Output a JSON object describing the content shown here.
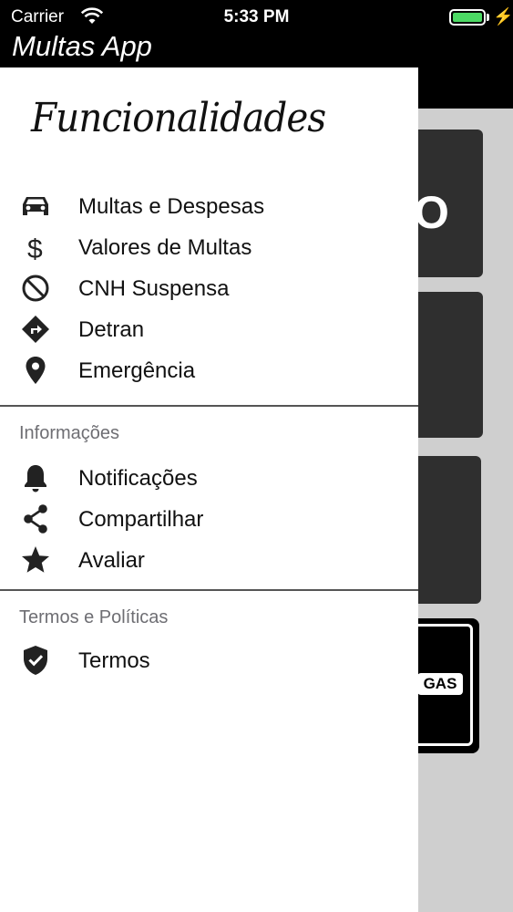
{
  "status_bar": {
    "carrier": "Carrier",
    "time": "5:33 PM",
    "battery_level": 1.0
  },
  "nav": {
    "title": "Multas App"
  },
  "background": {
    "card1_text": "O",
    "sign_label": "GAS"
  },
  "drawer": {
    "title": "Funcionalidades",
    "main_items": [
      {
        "label": "Multas e Despesas",
        "icon": "car-icon"
      },
      {
        "label": "Valores de Multas",
        "icon": "dollar-icon"
      },
      {
        "label": "CNH Suspensa",
        "icon": "block-icon"
      },
      {
        "label": "Detran",
        "icon": "directions-icon"
      },
      {
        "label": "Emergência",
        "icon": "location-pin-icon"
      }
    ],
    "info_section": {
      "title": "Informações",
      "items": [
        {
          "label": "Notificações",
          "icon": "bell-icon"
        },
        {
          "label": "Compartilhar",
          "icon": "share-icon"
        },
        {
          "label": "Avaliar",
          "icon": "star-icon"
        }
      ]
    },
    "terms_section": {
      "title": "Termos e Políticas",
      "items": [
        {
          "label": "Termos",
          "icon": "shield-check-icon"
        }
      ]
    }
  }
}
